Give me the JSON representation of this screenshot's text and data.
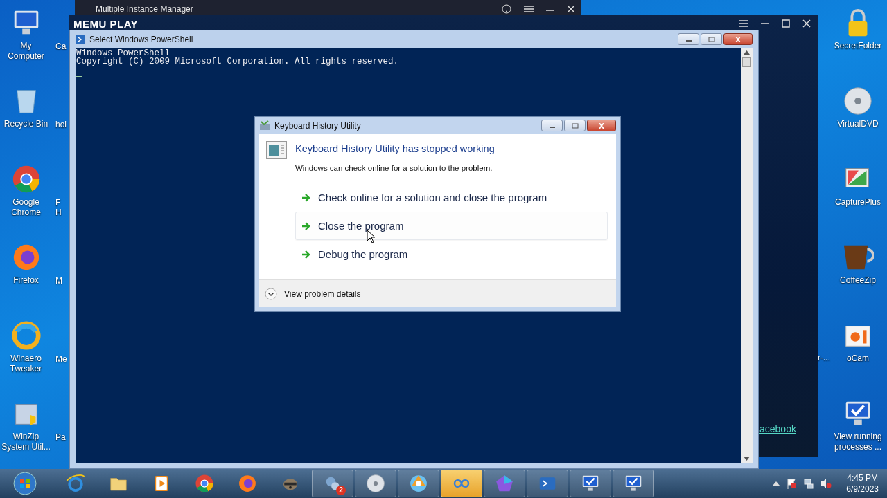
{
  "desktop_left": [
    {
      "lines": [
        "My",
        "Computer"
      ]
    },
    {
      "lines": [
        "Recycle Bin"
      ]
    },
    {
      "lines": [
        "Google",
        "Chrome"
      ]
    },
    {
      "lines": [
        "Firefox"
      ]
    },
    {
      "lines": [
        "Winaero",
        "Tweaker"
      ]
    },
    {
      "lines": [
        "WinZip",
        "System Util..."
      ]
    }
  ],
  "desktop_partial": [
    {
      "lines": [
        "Ca"
      ]
    },
    {
      "lines": [
        "hol"
      ]
    },
    {
      "lines": [
        "F",
        "H"
      ]
    },
    {
      "lines": [
        "M"
      ]
    },
    {
      "lines": [
        "Me"
      ]
    },
    {
      "lines": [
        "Pa"
      ]
    }
  ],
  "desktop_right": [
    {
      "lines": [
        "SecretFolder"
      ]
    },
    {
      "lines": [
        "VirtualDVD"
      ]
    },
    {
      "lines": [
        "CapturePlus"
      ]
    },
    {
      "lines": [
        "CoffeeZip"
      ]
    },
    {
      "lines": [
        "oCam"
      ]
    },
    {
      "lines": [
        "View running",
        "processes ..."
      ]
    }
  ],
  "hidden_icon_label": "r-...",
  "instance_manager": {
    "title": "Multiple Instance Manager"
  },
  "memu": {
    "logo": "MEMU PLAY",
    "link": "acebook"
  },
  "powershell": {
    "title": "Select Windows PowerShell",
    "lines": [
      "Windows PowerShell",
      "Copyright (C) 2009 Microsoft Corporation. All rights reserved."
    ]
  },
  "dialog": {
    "title": "Keyboard History Utility",
    "heading": "Keyboard History Utility has stopped working",
    "message": "Windows can check online for a solution to the problem.",
    "options": [
      {
        "label": "Check online for a solution and close the program",
        "selected": false
      },
      {
        "label": "Close the program",
        "selected": true
      },
      {
        "label": "Debug the program",
        "selected": false
      }
    ],
    "details": "View problem details"
  },
  "taskbar": {
    "items": [
      {
        "kind": "pinned",
        "selected": false
      },
      {
        "kind": "pinned",
        "selected": false
      },
      {
        "kind": "pinned",
        "selected": false
      },
      {
        "kind": "pinned",
        "selected": false
      },
      {
        "kind": "pinned",
        "selected": false
      },
      {
        "kind": "pinned",
        "selected": false
      },
      {
        "kind": "running",
        "selected": false,
        "badge": "2"
      },
      {
        "kind": "running",
        "selected": false
      },
      {
        "kind": "running",
        "selected": false
      },
      {
        "kind": "running",
        "selected": true
      },
      {
        "kind": "running",
        "selected": false
      },
      {
        "kind": "running",
        "selected": false
      },
      {
        "kind": "running",
        "selected": false
      },
      {
        "kind": "running",
        "selected": false
      }
    ],
    "time": "4:45 PM",
    "date": "6/9/2023"
  }
}
